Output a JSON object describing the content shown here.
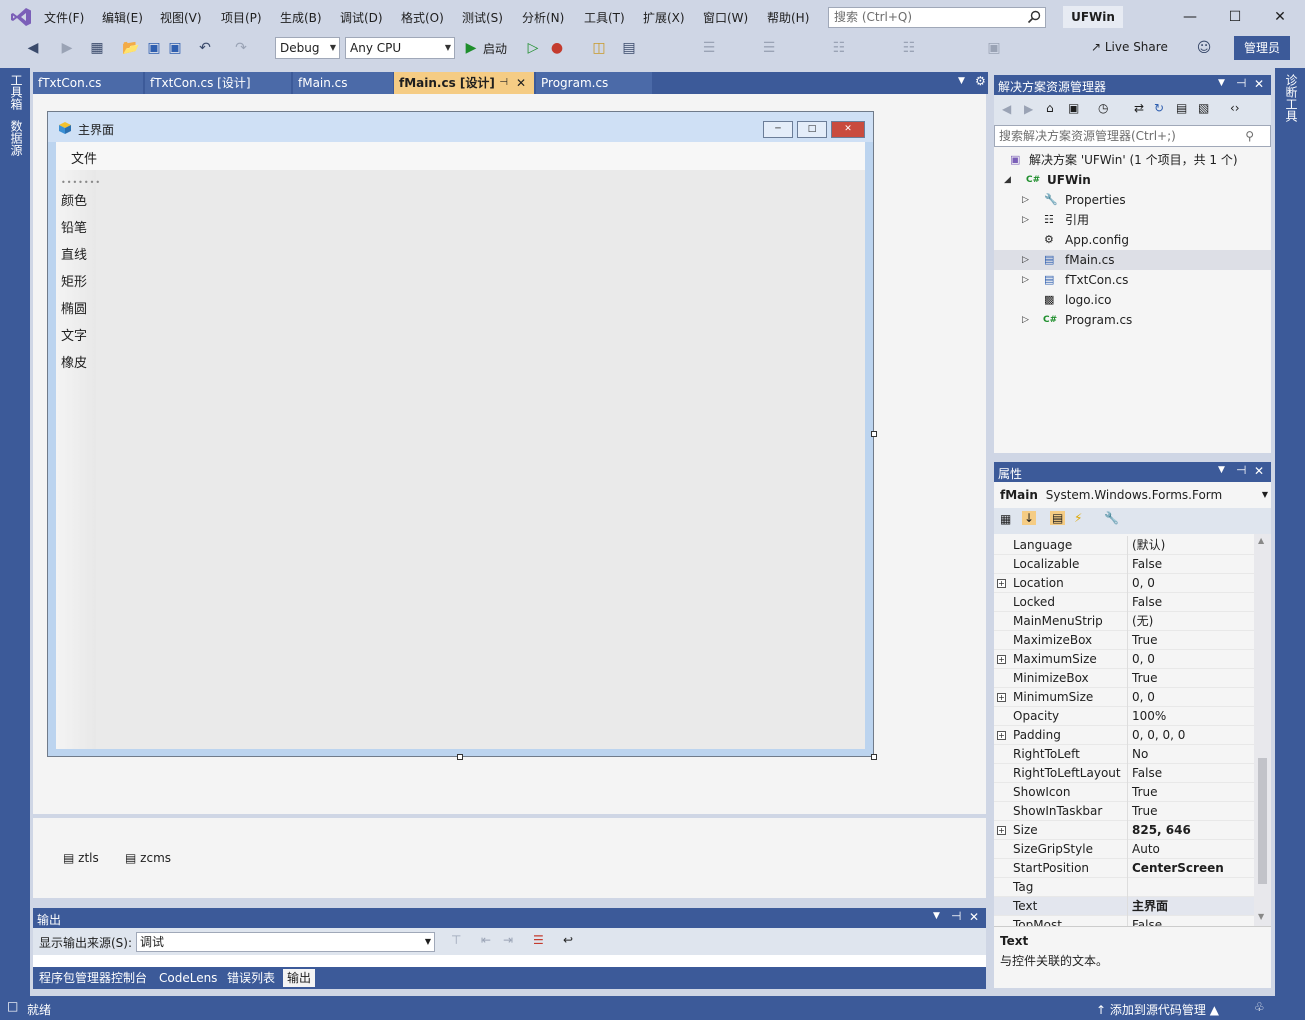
{
  "menu": {
    "items": [
      "文件(F)",
      "编辑(E)",
      "视图(V)",
      "项目(P)",
      "生成(B)",
      "调试(D)",
      "格式(O)",
      "测试(S)",
      "分析(N)",
      "工具(T)",
      "扩展(X)",
      "窗口(W)",
      "帮助(H)"
    ],
    "search_placeholder": "搜索 (Ctrl+Q)",
    "solution_name": "UFWin"
  },
  "toolbar": {
    "config": "Debug",
    "platform": "Any CPU",
    "start_label": "启动",
    "live_share": "Live Share",
    "admin": "管理员"
  },
  "left_strip": {
    "toolbox": "工具箱",
    "datasource": "数据源"
  },
  "right_strip": {
    "diagnostics": "诊断工具"
  },
  "doc_tabs": [
    "fTxtCon.cs",
    "fTxtCon.cs [设计]",
    "fMain.cs",
    "fMain.cs [设计]",
    "Program.cs"
  ],
  "form": {
    "title": "主界面",
    "menu_file": "文件",
    "tools": [
      "颜色",
      "铅笔",
      "直线",
      "矩形",
      "椭圆",
      "文字",
      "橡皮"
    ]
  },
  "tray": {
    "items": [
      "ztls",
      "zcms"
    ]
  },
  "output": {
    "title": "输出",
    "source_label": "显示输出来源(S):",
    "source_value": "调试"
  },
  "bottom_tabs": [
    "程序包管理器控制台",
    "CodeLens",
    "错误列表",
    "输出"
  ],
  "status": {
    "text": "就绪",
    "source_control": "添加到源代码管理"
  },
  "solution_explorer": {
    "title": "解决方案资源管理器",
    "search_placeholder": "搜索解决方案资源管理器(Ctrl+;)",
    "solution_label": "解决方案 'UFWin' (1 个项目，共 1 个)",
    "project": "UFWin",
    "items": [
      "Properties",
      "引用",
      "App.config",
      "fMain.cs",
      "fTxtCon.cs",
      "logo.ico",
      "Program.cs"
    ]
  },
  "properties": {
    "title": "属性",
    "object_name": "fMain",
    "object_type": "System.Windows.Forms.Form",
    "rows": [
      {
        "name": "Language",
        "value": "(默认)"
      },
      {
        "name": "Localizable",
        "value": "False"
      },
      {
        "name": "Location",
        "value": "0, 0"
      },
      {
        "name": "Locked",
        "value": "False"
      },
      {
        "name": "MainMenuStrip",
        "value": "(无)"
      },
      {
        "name": "MaximizeBox",
        "value": "True"
      },
      {
        "name": "MaximumSize",
        "value": "0, 0"
      },
      {
        "name": "MinimizeBox",
        "value": "True"
      },
      {
        "name": "MinimumSize",
        "value": "0, 0"
      },
      {
        "name": "Opacity",
        "value": "100%"
      },
      {
        "name": "Padding",
        "value": "0, 0, 0, 0"
      },
      {
        "name": "RightToLeft",
        "value": "No"
      },
      {
        "name": "RightToLeftLayout",
        "value": "False"
      },
      {
        "name": "ShowIcon",
        "value": "True"
      },
      {
        "name": "ShowInTaskbar",
        "value": "True"
      },
      {
        "name": "Size",
        "value": "825, 646"
      },
      {
        "name": "SizeGripStyle",
        "value": "Auto"
      },
      {
        "name": "StartPosition",
        "value": "CenterScreen"
      },
      {
        "name": "Tag",
        "value": ""
      },
      {
        "name": "Text",
        "value": "主界面"
      },
      {
        "name": "TopMost",
        "value": "False"
      }
    ],
    "desc_title": "Text",
    "desc_text": "与控件关联的文本。"
  },
  "colors": {
    "accent": "#3c5a99",
    "active_tab": "#f5cc84"
  }
}
